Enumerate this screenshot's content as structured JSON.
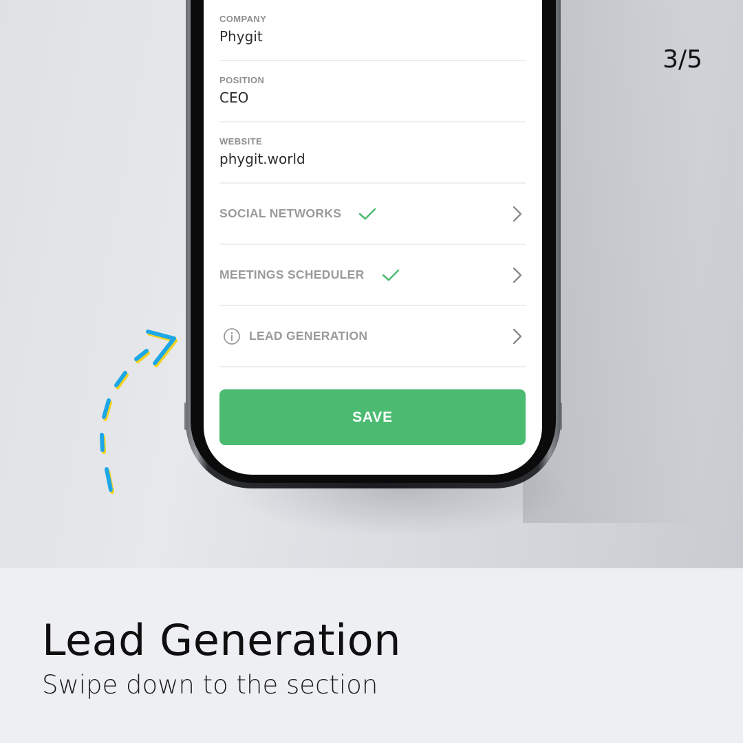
{
  "page_counter": "3/5",
  "form": {
    "company": {
      "label": "COMPANY",
      "value": "Phygit"
    },
    "position": {
      "label": "POSITION",
      "value": "CEO"
    },
    "website": {
      "label": "WEBSITE",
      "value": "phygit.world"
    },
    "rows": [
      {
        "label": "SOCIAL NETWORKS",
        "icon": "check-icon"
      },
      {
        "label": "MEETINGS SCHEDULER",
        "icon": "check-icon"
      },
      {
        "label": "LEAD GENERATION",
        "icon": "info-icon"
      }
    ],
    "save_label": "SAVE"
  },
  "caption": {
    "title": "Lead Generation",
    "subtitle": "Swipe down to the section"
  },
  "colors": {
    "accent_green": "#4cbb72",
    "arrow_blue": "#1ea7e6",
    "arrow_yellow": "#f4d21f"
  }
}
